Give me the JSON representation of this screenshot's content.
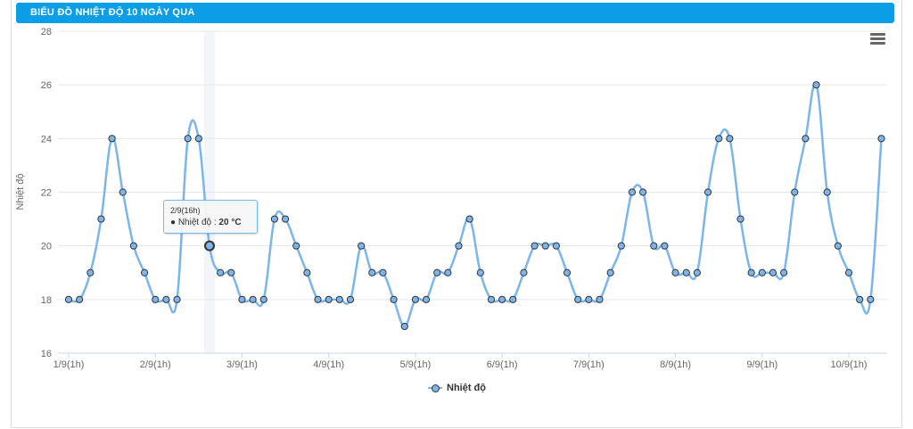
{
  "header": {
    "title": "BIỂU ĐỒ NHIỆT ĐỘ 10 NGÀY QUA"
  },
  "menu": {
    "icon": "hamburger-menu-icon"
  },
  "tooltip": {
    "header": "2/9(16h)",
    "series": "Nhiệt độ",
    "value": "20 °C"
  },
  "legend": {
    "label": "Nhiệt độ"
  },
  "colors": {
    "header": "#0b9ee6",
    "series": "#7cb5ec",
    "grid": "#e6e6e6"
  },
  "chart_data": {
    "type": "line",
    "title": "BIỂU ĐỒ NHIỆT ĐỘ 10 NGÀY QUA",
    "xlabel": "",
    "ylabel": "Nhiệt độ",
    "ylim": [
      16,
      28
    ],
    "yticks": [
      16,
      18,
      20,
      22,
      24,
      26,
      28
    ],
    "xtick_labels": [
      "1/9(1h)",
      "2/9(1h)",
      "3/9(1h)",
      "4/9(1h)",
      "5/9(1h)",
      "6/9(1h)",
      "7/9(1h)",
      "8/9(1h)",
      "9/9(1h)",
      "10/9(1h)"
    ],
    "points_per_day": 8,
    "grid": true,
    "legend_position": "bottom-center",
    "highlighted_point": {
      "x": "2/9(16h)",
      "y": 20
    },
    "series": [
      {
        "name": "Nhiệt độ",
        "values": [
          18,
          18,
          19,
          21,
          24,
          22,
          20,
          19,
          18,
          18,
          18,
          24,
          24,
          20,
          19,
          19,
          18,
          18,
          18,
          21,
          21,
          20,
          19,
          18,
          18,
          18,
          18,
          20,
          19,
          19,
          18,
          17,
          18,
          18,
          19,
          19,
          20,
          21,
          19,
          18,
          18,
          18,
          19,
          20,
          20,
          20,
          19,
          18,
          18,
          18,
          19,
          20,
          22,
          22,
          20,
          20,
          19,
          19,
          19,
          22,
          24,
          24,
          21,
          19,
          19,
          19,
          19,
          22,
          24,
          26,
          22,
          20,
          19,
          18,
          18,
          24
        ]
      }
    ]
  }
}
